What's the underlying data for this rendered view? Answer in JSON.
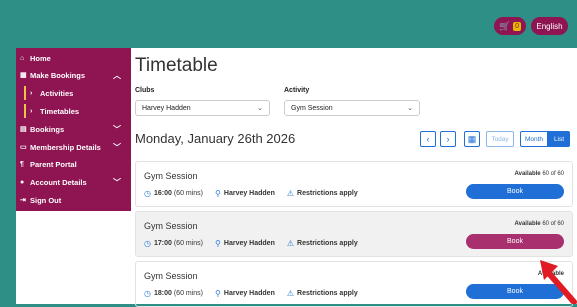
{
  "header": {
    "cart_count": "0",
    "language": "English"
  },
  "sidebar": {
    "items": [
      {
        "label": "Home",
        "icon": "home-icon"
      },
      {
        "label": "Make Bookings",
        "icon": "calendar-icon",
        "chevron": "up"
      },
      {
        "label": "Activities",
        "sub": true
      },
      {
        "label": "Timetables",
        "sub": true
      },
      {
        "label": "Bookings",
        "icon": "book-icon",
        "chevron": "down"
      },
      {
        "label": "Membership Details",
        "icon": "card-icon",
        "chevron": "down"
      },
      {
        "label": "Parent Portal",
        "icon": "user-icon"
      },
      {
        "label": "Account Details",
        "icon": "person-icon",
        "chevron": "down"
      },
      {
        "label": "Sign Out",
        "icon": "sign-out-icon"
      }
    ]
  },
  "main": {
    "title": "Timetable",
    "clubs_label": "Clubs",
    "clubs_value": "Harvey Hadden",
    "activity_label": "Activity",
    "activity_value": "Gym Session",
    "date": "Monday, January 26th 2026",
    "today_label": "Today",
    "month_label": "Month",
    "list_label": "List"
  },
  "sessions": [
    {
      "title": "Gym Session",
      "time": "16:00",
      "duration": "(60 mins)",
      "venue": "Harvey Hadden",
      "restriction": "Restrictions apply",
      "available_label": "Available",
      "available_value": "60 of 60",
      "book_label": "Book"
    },
    {
      "title": "Gym Session",
      "time": "17:00",
      "duration": "(60 mins)",
      "venue": "Harvey Hadden",
      "restriction": "Restrictions apply",
      "available_label": "Available",
      "available_value": "60 of 60",
      "book_label": "Book"
    },
    {
      "title": "Gym Session",
      "time": "18:00",
      "duration": "(60 mins)",
      "venue": "Harvey Hadden",
      "restriction": "Restrictions apply",
      "available_label": "Available",
      "available_value": "",
      "book_label": "Book"
    }
  ],
  "colors": {
    "brand": "#8e1452",
    "teal": "#2e8f87",
    "primary": "#1f6fd6",
    "book_hover": "#a8306f",
    "arrow": "#e01b24"
  }
}
